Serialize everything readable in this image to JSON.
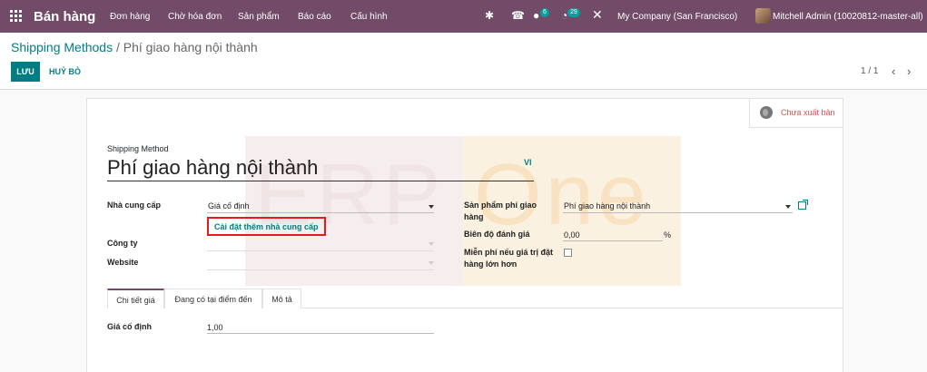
{
  "navbar": {
    "app_name": "Bán hàng",
    "menu": [
      "Đơn hàng",
      "Chờ hóa đơn",
      "Sản phẩm",
      "Báo cáo",
      "Cấu hình"
    ],
    "chat_count": "6",
    "activity_count": "29",
    "company": "My Company (San Francisco)",
    "user": "Mitchell Admin (10020812-master-all)"
  },
  "breadcrumb": {
    "parent": "Shipping Methods",
    "separator": " / ",
    "current": "Phí giao hàng nội thành"
  },
  "actions": {
    "save": "LƯU",
    "discard": "HUỶ BỎ"
  },
  "pager": {
    "value": "1 / 1"
  },
  "smart_button": {
    "label": "Chưa xuất bản"
  },
  "watermark": {
    "left": "ERP",
    "right": "One"
  },
  "form": {
    "title_label": "Shipping Method",
    "title_value": "Phí giao hàng nội thành",
    "lang": "VI",
    "provider_label": "Nhà cung cấp",
    "provider_value": "Giá cố định",
    "install_more": "Cài đặt thêm nhà cung cấp",
    "company_label": "Công ty",
    "website_label": "Website",
    "product_label": "Sản phẩm phí giao hàng",
    "product_value": "Phí giao hàng nội thành",
    "margin_label": "Biên độ đánh giá",
    "margin_value": "0,00",
    "margin_unit": "%",
    "free_label": "Miễn phí nếu giá trị đặt hàng lớn hơn"
  },
  "tabs": [
    "Chi tiết giá",
    "Đang có tại điểm đến",
    "Mô tả"
  ],
  "tab_content": {
    "fixed_price_label": "Giá cố định",
    "fixed_price_value": "1,00"
  },
  "colors": {
    "brand": "#714b67",
    "accent": "#017e84",
    "highlight": "#e21c1c"
  }
}
